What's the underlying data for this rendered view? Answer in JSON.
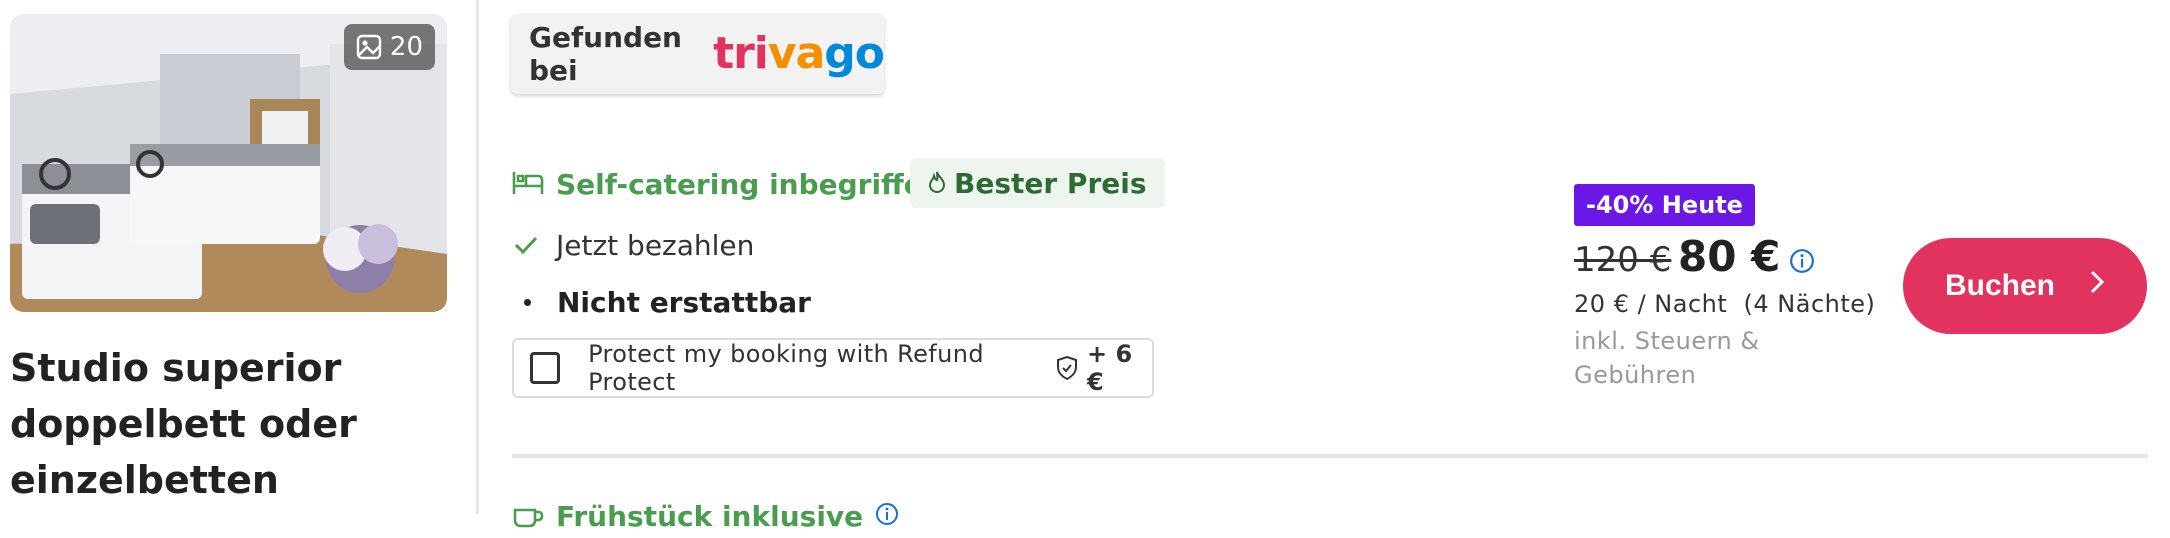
{
  "hotel_card": {
    "photo_count": "20",
    "room_title": "Studio superior doppelbett oder einzelbetten"
  },
  "found_badge": {
    "label": "Gefunden bei",
    "brand": "trivago",
    "brand_colors": [
      "#e2335f",
      "#f48f00",
      "#0088d9"
    ]
  },
  "offer": {
    "meal": "Self-catering inbegriffen",
    "best_price_badge": "Bester Preis",
    "payment": "Jetzt bezahlen",
    "refund_policy": "Nicht erstattbar",
    "protect_label": "Protect my booking with Refund Protect",
    "protect_price": "+ 6 €",
    "discount_badge": "-40% Heute",
    "old_price": "120 €",
    "new_price": "80 €",
    "per_night": "20 € / Nacht  (4 Nächte)",
    "tax_note": "inkl. Steuern & Gebühren",
    "book_label": "Buchen"
  },
  "next_offer": {
    "meal": "Frühstück inklusive"
  },
  "colors": {
    "green": "#4a9d4f",
    "purple_badge": "#6b18e6",
    "book_button": "#e2335f",
    "info_blue": "#1a6fd6"
  }
}
